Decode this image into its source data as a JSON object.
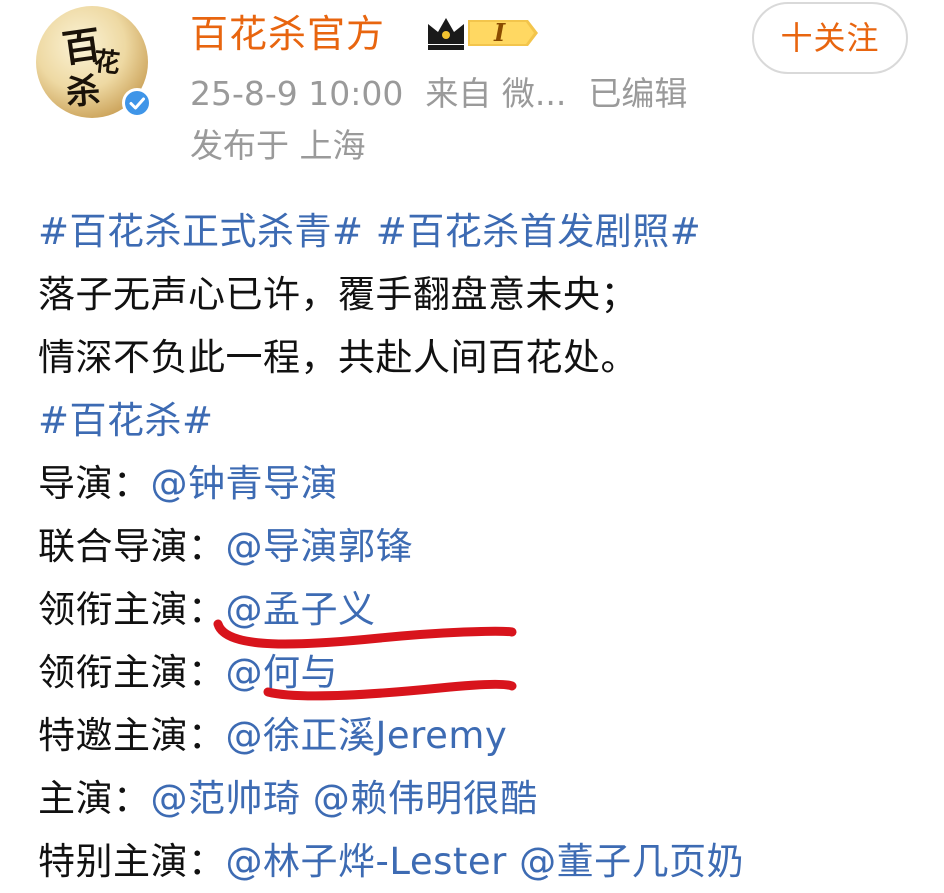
{
  "account": {
    "name": "百花杀官方",
    "vip_level": "I",
    "avatar_calligraphy": [
      "百",
      "花",
      "杀"
    ]
  },
  "follow_button": {
    "label": "十关注"
  },
  "meta": {
    "date": "25-8-9 10:00",
    "source": "来自 微...",
    "edited": "已编辑",
    "location": "发布于 上海"
  },
  "post": {
    "hashtags_line": "#百花杀正式杀青# #百花杀首发剧照#",
    "poem_line1": "落子无声心已许，覆手翻盘意未央；",
    "poem_line2": "情深不负此一程，共赴人间百花处。",
    "hashtag2": "#百花杀#",
    "credits": [
      {
        "label": "导演：",
        "mentions": "@钟青导演"
      },
      {
        "label": "联合导演：",
        "mentions": "@导演郭锋"
      },
      {
        "label": "领衔主演：",
        "mentions": "@孟子义"
      },
      {
        "label": "领衔主演：",
        "mentions": "@何与"
      },
      {
        "label": "特邀主演：",
        "mentions": "@徐正溪Jeremy"
      },
      {
        "label": "主演：",
        "mentions": "@范帅琦 @赖伟明很酷"
      },
      {
        "label": "特别主演：",
        "mentions": "@林子烨-Lester @董子几页奶"
      }
    ]
  },
  "colors": {
    "accent_orange": "#e8650f",
    "link_blue": "#3d6bb3",
    "meta_gray": "#9a9a9a",
    "verify_blue": "#3f95e8",
    "annotation_red": "#d8141c"
  },
  "icons": {
    "verify": "verified-check-icon",
    "vip": "crown-vip-icon"
  }
}
